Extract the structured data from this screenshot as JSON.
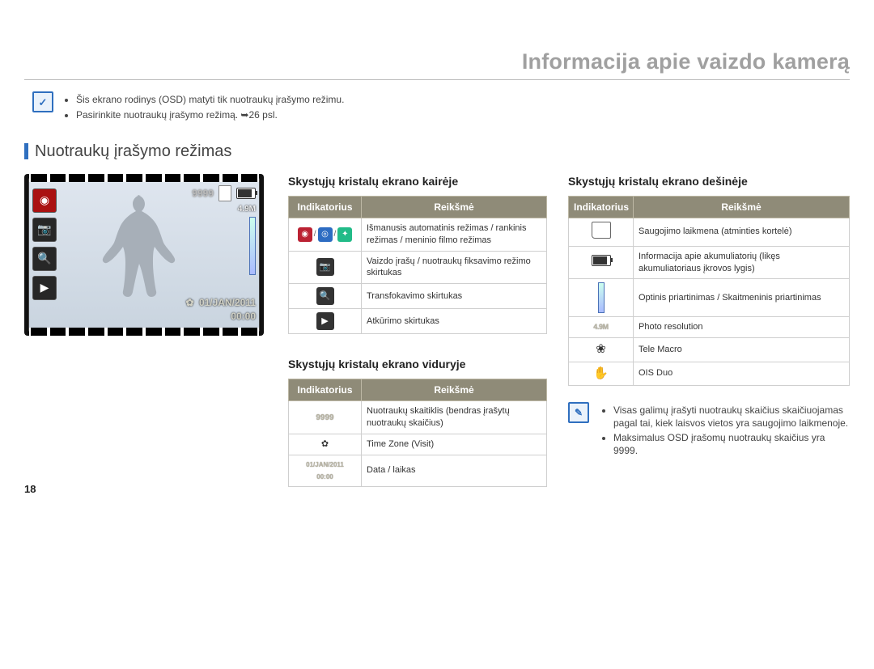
{
  "title": "Informacija apie vaizdo kamerą",
  "notes": [
    "Šis ekrano rodinys (OSD) matyti tik nuotraukų įrašymo režimu.",
    "Pasirinkite nuotraukų įrašymo režimą. ➥26 psl."
  ],
  "section_heading": "Nuotraukų įrašymo režimas",
  "lcd": {
    "counter": "9999",
    "res": "4.9M",
    "date": "01/JAN/2011",
    "time": "00:00"
  },
  "tables": {
    "left": {
      "title": "Skystųjų kristalų ekrano kairėje",
      "head": {
        "col1": "Indikatorius",
        "col2": "Reikšmė"
      },
      "rows": [
        {
          "icon": "modes",
          "meaning": "Išmanusis automatinis režimas / rankinis režimas / meninio filmo režimas"
        },
        {
          "icon": "cam-photo",
          "meaning": "Vaizdo įrašų / nuotraukų fiksavimo režimo skirtukas"
        },
        {
          "icon": "zoom-glass",
          "meaning": "Transfokavimo skirtukas"
        },
        {
          "icon": "play",
          "meaning": "Atkūrimo skirtukas"
        }
      ]
    },
    "middle": {
      "title": "Skystųjų kristalų ekrano viduryje",
      "head": {
        "col1": "Indikatorius",
        "col2": "Reikšmė"
      },
      "rows": [
        {
          "icon": "count",
          "text": "9999",
          "meaning": "Nuotraukų skaitiklis (bendras įrašytų nuotraukų skaičius)"
        },
        {
          "icon": "timezone",
          "meaning": "Time Zone (Visit)"
        },
        {
          "icon": "datetime",
          "text1": "01/JAN/2011",
          "text2": "00:00",
          "meaning": "Data / laikas"
        }
      ]
    },
    "right": {
      "title": "Skystųjų kristalų ekrano dešinėje",
      "head": {
        "col1": "Indikatorius",
        "col2": "Reikšmė"
      },
      "rows": [
        {
          "icon": "card",
          "meaning": "Saugojimo laikmena (atminties kortelė)"
        },
        {
          "icon": "battery",
          "meaning": "Informacija apie akumuliatorių (likęs akumuliatoriaus įkrovos lygis)"
        },
        {
          "icon": "zoom-bar",
          "meaning": "Optinis priartinimas / Skaitmeninis priartinimas"
        },
        {
          "icon": "res",
          "text": "4.9M",
          "meaning": "Photo resolution"
        },
        {
          "icon": "flower",
          "meaning": "Tele Macro"
        },
        {
          "icon": "hand",
          "meaning": "OIS Duo"
        }
      ]
    }
  },
  "info_notes": [
    "Visas galimų įrašyti nuotraukų skaičius skaičiuojamas pagal tai, kiek laisvos vietos yra saugojimo laikmenoje.",
    "Maksimalus OSD įrašomų nuotraukų skaičius yra 9999."
  ],
  "page_number": "18"
}
